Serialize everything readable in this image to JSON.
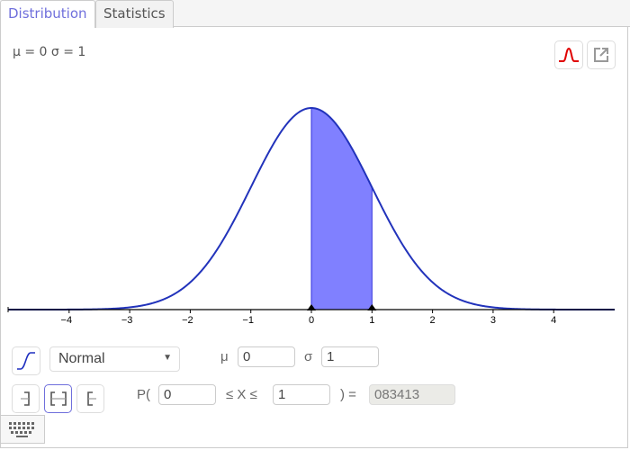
{
  "tabs": [
    {
      "label": "Distribution",
      "active": true
    },
    {
      "label": "Statistics",
      "active": false
    }
  ],
  "params_label": "μ = 0 σ = 1",
  "toolbar": {
    "density_icon": "normal-curve-icon",
    "export_icon": "export-icon"
  },
  "distribution": {
    "cumulative_toggle_icon": "cumulative-curve-icon",
    "selected": "Normal",
    "mu_label": "μ",
    "mu_value": "0",
    "sigma_label": "σ",
    "sigma_value": "1"
  },
  "probability": {
    "modes": [
      {
        "name": "left-sided",
        "icon": "left-sided-icon",
        "selected": false
      },
      {
        "name": "interval",
        "icon": "interval-icon",
        "selected": true
      },
      {
        "name": "right-sided",
        "icon": "right-sided-icon",
        "selected": false
      }
    ],
    "p_open": "P(",
    "low": "0",
    "middle": "≤ X ≤",
    "high": "1",
    "close": ") =",
    "result": "083413"
  },
  "keyboard_icon": "keyboard-icon",
  "colors": {
    "curve": "#2233bb",
    "fill": "#8080ff",
    "tab_active": "#6f6fdc",
    "density_icon": "#e00000"
  },
  "chart_data": {
    "type": "area",
    "title": "",
    "distribution": "normal",
    "mean": 0,
    "sd": 1,
    "xlabel": "",
    "ylabel": "",
    "xlim": [
      -5,
      5
    ],
    "ylim": [
      0,
      0.4
    ],
    "x_ticks": [
      -4,
      -3,
      -2,
      -1,
      0,
      1,
      2,
      3,
      4
    ],
    "x_tick_labels": [
      "−4",
      "−3",
      "−2",
      "−1",
      "0",
      "1",
      "2",
      "3",
      "4"
    ],
    "shaded_interval": [
      0,
      1
    ],
    "markers": [
      0,
      1
    ],
    "grid": false
  }
}
